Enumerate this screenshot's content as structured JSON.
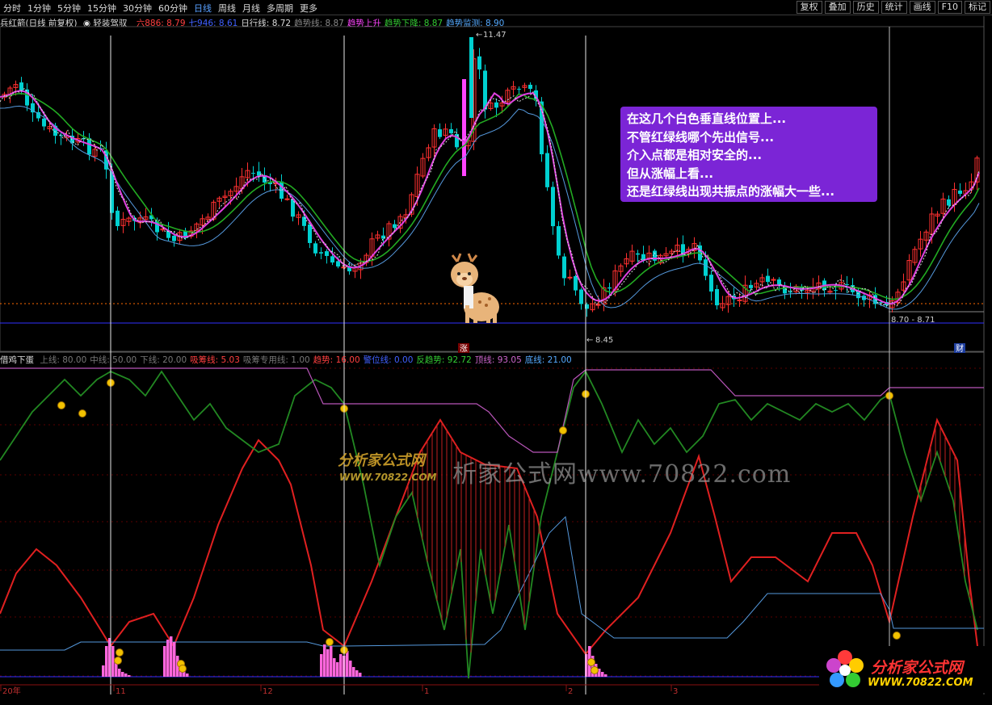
{
  "toolbar": {
    "periods": [
      "分时",
      "1分钟",
      "5分钟",
      "15分钟",
      "30分钟",
      "60分钟",
      "日线",
      "周线",
      "月线",
      "多周期",
      "更多"
    ],
    "active_period": "日线",
    "right_buttons": [
      "复权",
      "叠加",
      "历史",
      "统计",
      "画线",
      "F10",
      "标记"
    ]
  },
  "main_info": {
    "stock": "兵红箭(日线 前复权)",
    "dropdown": "轻装驾驭",
    "items": [
      {
        "label": "六886: 8.79",
        "color": "#ff4040"
      },
      {
        "label": "七946: 8.61",
        "color": "#4060ff"
      },
      {
        "label": "日行线: 8.72",
        "color": "#dddddd"
      },
      {
        "label": "趋势线: 8.87",
        "color": "#888888"
      },
      {
        "label": "趋势上升",
        "color": "#ff44ff"
      },
      {
        "label": "趋势下降: 8.87",
        "color": "#33cc33"
      },
      {
        "label": "趋势监测: 8.90",
        "color": "#55aaff"
      }
    ]
  },
  "price_labels": {
    "high": "11.47",
    "low": "8.45",
    "last": "8.70 - 8.71"
  },
  "markers": {
    "zhang": "涨",
    "cai": "财"
  },
  "annotation_lines": [
    "在这几个白色垂直线位置上...",
    "不管红绿线哪个先出信号...",
    "介入点都是相对安全的...",
    "但从涨幅上看...",
    "还是红绿线出现共振点的涨幅大一些..."
  ],
  "sub_info": {
    "name": "借鸡下蛋",
    "items": [
      {
        "label": "上线: 80.00",
        "color": "#777777"
      },
      {
        "label": "中线: 50.00",
        "color": "#777777"
      },
      {
        "label": "下线: 20.00",
        "color": "#777777"
      },
      {
        "label": "吸筹线: 5.03",
        "color": "#ff4040"
      },
      {
        "label": "吸筹专用线: 1.00",
        "color": "#777777"
      },
      {
        "label": "趋势: 16.00",
        "color": "#ff4040"
      },
      {
        "label": "警位线: 0.00",
        "color": "#4060ff"
      },
      {
        "label": "反趋势: 92.72",
        "color": "#33cc33"
      },
      {
        "label": "顶线: 93.05",
        "color": "#cc66cc"
      },
      {
        "label": "底线: 21.00",
        "color": "#55aaff"
      }
    ]
  },
  "x_axis": [
    "20年",
    "11",
    "12",
    "1",
    "2",
    "3"
  ],
  "watermark": {
    "site_cn": "分析家公式网",
    "site_url": "WWW.70822.COM",
    "faint": "析家公式网www.70822.com"
  },
  "logo": {
    "title": "分析家公式网",
    "url": "WWW.70822.COM"
  },
  "colors": {
    "up": "#ff3030",
    "down": "#00d0d0",
    "green_line": "#22aa22",
    "magenta_line": "#e040e0",
    "blue_line": "#5599dd",
    "purple_bubble": "#7b25d6"
  }
}
